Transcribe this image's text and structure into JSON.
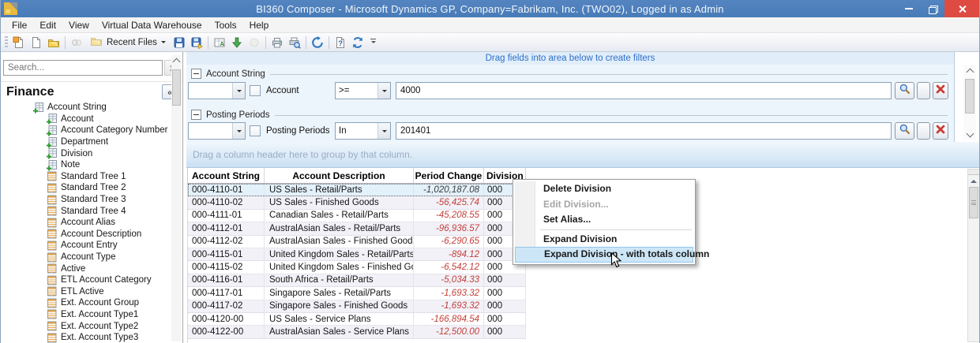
{
  "window": {
    "title": "BI360 Composer - Microsoft Dynamics GP, Company=Fabrikam, Inc. (TWO02), Logged in as Admin"
  },
  "menu_bar": {
    "items": [
      "File",
      "Edit",
      "View",
      "Virtual Data Warehouse",
      "Tools",
      "Help"
    ]
  },
  "toolbar": {
    "recent_files_label": "Recent Files",
    "items": [
      {
        "type": "icon",
        "name": "new-file-icon"
      },
      {
        "type": "icon",
        "name": "blank-page-icon"
      },
      {
        "type": "icon",
        "name": "open-folder-icon"
      },
      {
        "type": "sep"
      },
      {
        "type": "icon",
        "name": "link-chain-icon",
        "disabled": true
      },
      {
        "type": "button",
        "name": "recent-files-button"
      },
      {
        "type": "icon",
        "name": "save-icon"
      },
      {
        "type": "icon",
        "name": "save-all-icon"
      },
      {
        "type": "sep"
      },
      {
        "type": "icon",
        "name": "export-grid-icon"
      },
      {
        "type": "icon",
        "name": "import-green-arrow-icon"
      },
      {
        "type": "icon",
        "name": "merge-circle-icon",
        "disabled": true
      },
      {
        "type": "sep"
      },
      {
        "type": "icon",
        "name": "print-icon"
      },
      {
        "type": "icon",
        "name": "print-preview-icon"
      },
      {
        "type": "sep"
      },
      {
        "type": "icon",
        "name": "process-gear-icon"
      },
      {
        "type": "sep"
      },
      {
        "type": "icon",
        "name": "help-icon"
      },
      {
        "type": "icon",
        "name": "refresh-icon"
      },
      {
        "type": "overflow",
        "name": "toolbar-overflow-button"
      }
    ]
  },
  "sidebar": {
    "search_placeholder": "Search...",
    "panel_title": "Finance",
    "collapse_glyph": "«",
    "tree": [
      {
        "label": "Account String",
        "icon": "field-add-icon",
        "level": 0
      },
      {
        "label": "Account",
        "icon": "field-add-icon",
        "level": 1
      },
      {
        "label": "Account Category Number",
        "icon": "field-add-icon",
        "level": 1
      },
      {
        "label": "Department",
        "icon": "field-add-icon",
        "level": 1
      },
      {
        "label": "Division",
        "icon": "field-add-icon",
        "level": 1
      },
      {
        "label": "Note",
        "icon": "field-add-icon",
        "level": 1
      },
      {
        "label": "Standard Tree 1",
        "icon": "attribute-table-icon",
        "level": 1
      },
      {
        "label": "Standard Tree 2",
        "icon": "attribute-table-icon",
        "level": 1
      },
      {
        "label": "Standard Tree 3",
        "icon": "attribute-table-icon",
        "level": 1
      },
      {
        "label": "Standard Tree 4",
        "icon": "attribute-table-icon",
        "level": 1
      },
      {
        "label": "Account Alias",
        "icon": "attribute-table-icon",
        "level": 1
      },
      {
        "label": "Account Description",
        "icon": "attribute-table-icon",
        "level": 1
      },
      {
        "label": "Account Entry",
        "icon": "attribute-table-icon",
        "level": 1
      },
      {
        "label": "Account Type",
        "icon": "attribute-table-icon",
        "level": 1
      },
      {
        "label": "Active",
        "icon": "attribute-table-icon",
        "level": 1
      },
      {
        "label": "ETL Account Category",
        "icon": "attribute-table-icon",
        "level": 1
      },
      {
        "label": "ETL Active",
        "icon": "attribute-table-icon",
        "level": 1
      },
      {
        "label": "Ext. Account Group",
        "icon": "attribute-table-icon",
        "level": 1
      },
      {
        "label": "Ext. Account Type1",
        "icon": "attribute-table-icon",
        "level": 1
      },
      {
        "label": "Ext. Account Type2",
        "icon": "attribute-table-icon",
        "level": 1
      },
      {
        "label": "Ext. Account Type3",
        "icon": "attribute-table-icon",
        "level": 1
      }
    ]
  },
  "filters": {
    "hint": "Drag fields into area below to create filters",
    "groups": [
      {
        "title": "Account String",
        "field": "Account",
        "operator": ">=",
        "value": "4000"
      },
      {
        "title": "Posting Periods",
        "field": "Posting Periods",
        "operator": "In",
        "value": "201401"
      }
    ]
  },
  "grid": {
    "group_hint": "Drag a column header here to group by that column.",
    "columns": [
      "Account String",
      "Account Description",
      "Period Change",
      "Division"
    ],
    "rows": [
      {
        "account_string": "000-4110-01",
        "description": "US Sales - Retail/Parts",
        "period_change": "-1,020,187.08",
        "division": "000",
        "selected": true,
        "change_tone": "dark"
      },
      {
        "account_string": "000-4110-02",
        "description": "US Sales - Finished Goods",
        "period_change": "-56,425.74",
        "division": "000",
        "change_tone": "red"
      },
      {
        "account_string": "000-4111-01",
        "description": "Canadian Sales - Retail/Parts",
        "period_change": "-45,208.55",
        "division": "000",
        "change_tone": "red"
      },
      {
        "account_string": "000-4112-01",
        "description": "AustralAsian Sales - Retail/Parts",
        "period_change": "-96,936.57",
        "division": "000",
        "change_tone": "red"
      },
      {
        "account_string": "000-4112-02",
        "description": "AustralAsian Sales - Finished Goods",
        "period_change": "-6,290.65",
        "division": "000",
        "change_tone": "red"
      },
      {
        "account_string": "000-4115-01",
        "description": "United Kingdom Sales - Retail/Parts",
        "period_change": "-894.12",
        "division": "000",
        "change_tone": "red"
      },
      {
        "account_string": "000-4115-02",
        "description": "United Kingdom Sales - Finished Goods",
        "period_change": "-6,542.12",
        "division": "000",
        "change_tone": "red"
      },
      {
        "account_string": "000-4116-01",
        "description": "South Africa - Retail/Parts",
        "period_change": "-5,034.33",
        "division": "000",
        "change_tone": "red"
      },
      {
        "account_string": "000-4117-01",
        "description": "Singapore Sales - Retail/Parts",
        "period_change": "-1,693.32",
        "division": "000",
        "change_tone": "red"
      },
      {
        "account_string": "000-4117-02",
        "description": "Singapore Sales - Finished Goods",
        "period_change": "-1,693.32",
        "division": "000",
        "change_tone": "red"
      },
      {
        "account_string": "000-4120-00",
        "description": "US Sales - Service Plans",
        "period_change": "-166,894.54",
        "division": "000",
        "change_tone": "red"
      },
      {
        "account_string": "000-4122-00",
        "description": "AustralAsian Sales - Service Plans",
        "period_change": "-12,500.00",
        "division": "000",
        "change_tone": "red"
      }
    ]
  },
  "context_menu": {
    "items": [
      {
        "label": "Delete Division",
        "state": "normal"
      },
      {
        "label": "Edit Division...",
        "state": "disabled"
      },
      {
        "label": "Set Alias...",
        "state": "normal"
      },
      {
        "type": "separator"
      },
      {
        "label": "Expand Division",
        "state": "normal"
      },
      {
        "label": "Expand Division - with totals column",
        "state": "highlighted"
      }
    ]
  },
  "colors": {
    "titlebar_blue": "#477bb7",
    "close_red": "#dd4b43",
    "hint_text_blue": "#2e6fc7",
    "negative_red": "#c4403a",
    "row_alt_lavender": "#f2f1f8",
    "selection_blue": "#e3f1fb",
    "menu_highlight": "#cde6f7"
  }
}
